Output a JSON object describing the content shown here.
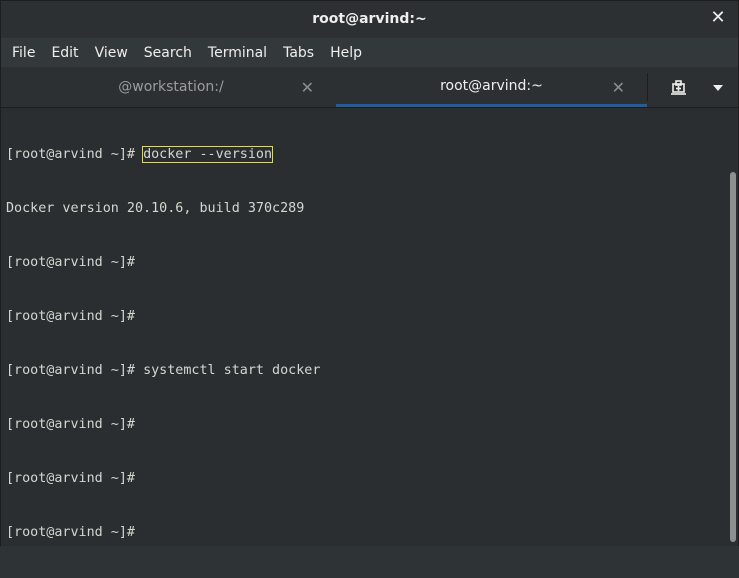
{
  "window": {
    "title": "root@arvind:~",
    "close_glyph": "✕"
  },
  "menu": {
    "items": [
      "File",
      "Edit",
      "View",
      "Search",
      "Terminal",
      "Tabs",
      "Help"
    ]
  },
  "tabs": [
    {
      "label": "@workstation:/",
      "active": false,
      "close_glyph": "✕"
    },
    {
      "label": "root@arvind:~",
      "active": true,
      "close_glyph": "✕"
    }
  ],
  "tabbar": {
    "new_tab_icon": "new-tab-icon",
    "dropdown_icon": "chevron-down-icon"
  },
  "terminal": {
    "lines": [
      {
        "prompt": "[root@arvind ~]# ",
        "command": "docker --version",
        "highlight": true
      },
      {
        "prompt": "",
        "command": "Docker version 20.10.6, build 370c289",
        "highlight": false
      },
      {
        "prompt": "[root@arvind ~]# ",
        "command": "",
        "highlight": false
      },
      {
        "prompt": "[root@arvind ~]# ",
        "command": "",
        "highlight": false
      },
      {
        "prompt": "[root@arvind ~]# ",
        "command": "systemctl start docker",
        "highlight": false
      },
      {
        "prompt": "[root@arvind ~]# ",
        "command": "",
        "highlight": false
      },
      {
        "prompt": "[root@arvind ~]# ",
        "command": "",
        "highlight": false
      },
      {
        "prompt": "[root@arvind ~]# ",
        "command": "",
        "highlight": false
      }
    ]
  },
  "colors": {
    "highlight_border": "#e2df3a",
    "active_tab_underline": "#215d9c",
    "terminal_text": "#d3d7cf"
  }
}
